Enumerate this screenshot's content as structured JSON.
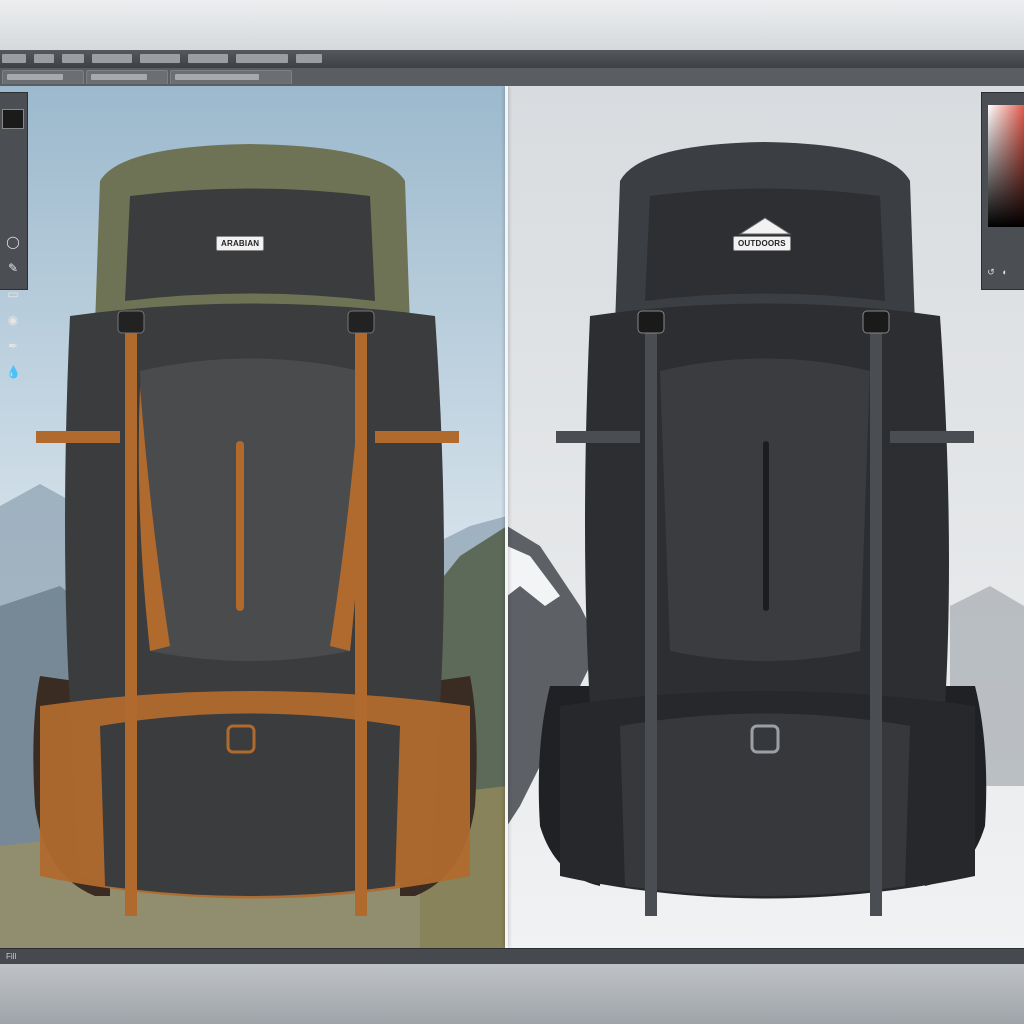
{
  "app": {
    "menu_items": [
      "",
      "",
      "",
      "",
      "",
      "",
      "",
      ""
    ],
    "tabs": [
      "",
      "",
      ""
    ],
    "status": "Fill"
  },
  "tools": {
    "icons": [
      "foreground-swatch",
      "lasso-icon",
      "brush-icon",
      "eraser-icon",
      "shape-icon",
      "pen-icon",
      "drop-icon"
    ]
  },
  "color_panel": {
    "accent": "#e04a3a",
    "icons": [
      "history-icon",
      "adjust-icon"
    ]
  },
  "compare": {
    "left": {
      "variant_colors": {
        "body": "#3a3c3e",
        "accent": "#b06a2e",
        "top": "#6f7355"
      },
      "label": "ARABIAN"
    },
    "right": {
      "variant_colors": {
        "body": "#2c2e31",
        "accent": "#4a4d51",
        "top": "#3b3e42"
      },
      "label": "OUTDOORS"
    }
  }
}
